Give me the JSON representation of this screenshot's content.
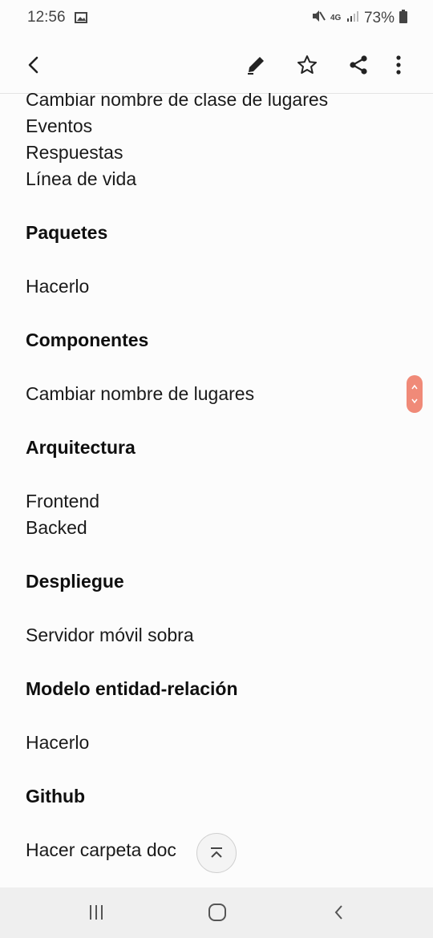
{
  "status_bar": {
    "time": "12:56",
    "network": "4G",
    "battery": "73%",
    "icons": [
      "gallery-icon",
      "mute-icon",
      "signal-icon",
      "battery-icon"
    ]
  },
  "toolbar": {
    "icons": [
      "back-icon",
      "edit-icon",
      "star-icon",
      "share-icon",
      "more-icon"
    ]
  },
  "note": {
    "lines": [
      {
        "text": "Cambiar nombre de clase de lugares",
        "heading": false
      },
      {
        "text": "Eventos",
        "heading": false
      },
      {
        "text": "Respuestas",
        "heading": false
      },
      {
        "text": "Línea de vida",
        "heading": false
      },
      {
        "text": "Paquetes",
        "heading": true
      },
      {
        "text": "Hacerlo",
        "heading": false
      },
      {
        "text": "Componentes",
        "heading": true
      },
      {
        "text": "Cambiar nombre de lugares",
        "heading": false
      },
      {
        "text": "Arquitectura",
        "heading": true
      },
      {
        "text": "Frontend",
        "heading": false
      },
      {
        "text": "Backed",
        "heading": false
      },
      {
        "text": "Despliegue",
        "heading": true
      },
      {
        "text": "Servidor móvil sobra",
        "heading": false
      },
      {
        "text": "Modelo entidad-relación",
        "heading": true
      },
      {
        "text": "Hacerlo",
        "heading": false
      },
      {
        "text": "Github",
        "heading": true
      },
      {
        "text": "Hacer carpeta doc",
        "heading": false
      }
    ]
  },
  "colors": {
    "accent": "#f08a78",
    "background": "#fcfcfc",
    "nav_background": "#efefef"
  },
  "nav_bar": {
    "icons": [
      "recent-apps-icon",
      "home-icon",
      "back-nav-icon"
    ]
  }
}
